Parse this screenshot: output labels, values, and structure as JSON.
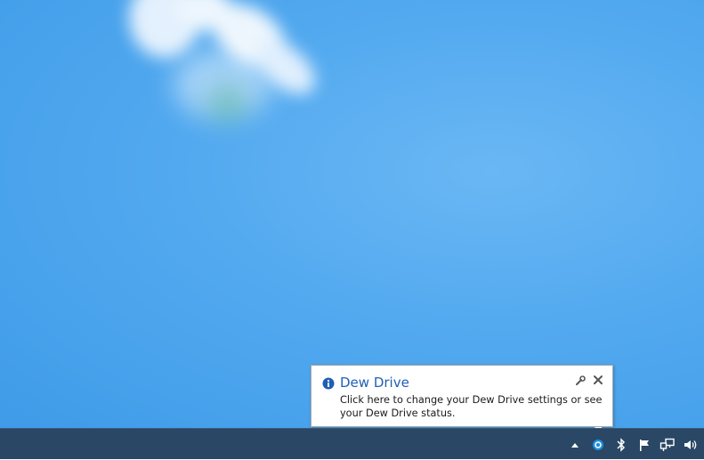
{
  "notification": {
    "title": "Dew Drive",
    "body": "Click here to change your Dew Drive settings or see your Dew Drive status.",
    "info_icon": "info-icon",
    "options_icon": "wrench-icon",
    "close_icon": "close-icon"
  },
  "tray": {
    "icons": [
      "show-hidden-icons-arrow-icon",
      "dew-drive-icon",
      "bluetooth-icon",
      "action-center-flag-icon",
      "network-icon",
      "volume-icon"
    ]
  },
  "colors": {
    "desktop": "#52a9ef",
    "taskbar": "#2a4766",
    "title": "#1f5fb4",
    "accent": "#1e8fe0"
  }
}
